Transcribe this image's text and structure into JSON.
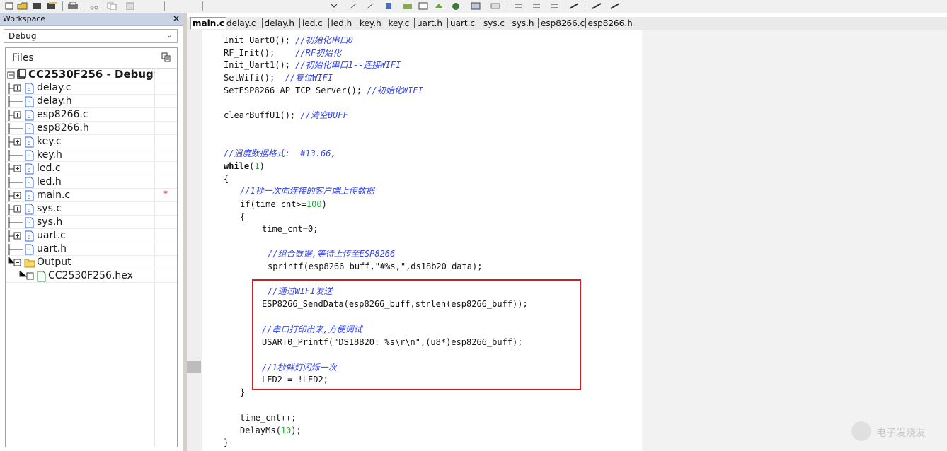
{
  "workspace": {
    "title": "Workspace",
    "close": "×",
    "config": "Debug",
    "files_header": "Files",
    "project": "CC2530F256 - Debug",
    "items": [
      {
        "name": "delay.c",
        "type": "c",
        "expandable": true
      },
      {
        "name": "delay.h",
        "type": "h",
        "expandable": false
      },
      {
        "name": "esp8266.c",
        "type": "c",
        "expandable": true
      },
      {
        "name": "esp8266.h",
        "type": "h",
        "expandable": false
      },
      {
        "name": "key.c",
        "type": "c",
        "expandable": true
      },
      {
        "name": "key.h",
        "type": "h",
        "expandable": false
      },
      {
        "name": "led.c",
        "type": "c",
        "expandable": true
      },
      {
        "name": "led.h",
        "type": "h",
        "expandable": false
      },
      {
        "name": "main.c",
        "type": "c",
        "expandable": true,
        "modified": "*"
      },
      {
        "name": "sys.c",
        "type": "c",
        "expandable": true
      },
      {
        "name": "sys.h",
        "type": "h",
        "expandable": false
      },
      {
        "name": "uart.c",
        "type": "c",
        "expandable": true
      },
      {
        "name": "uart.h",
        "type": "h",
        "expandable": false
      }
    ],
    "output_folder": "Output",
    "output_file": "CC2530F256.hex"
  },
  "editor": {
    "tabs": [
      "main.c",
      "delay.c",
      "delay.h",
      "led.c",
      "led.h",
      "key.h",
      "key.c",
      "uart.h",
      "uart.c",
      "sys.c",
      "sys.h",
      "esp8266.c",
      "esp8266.h"
    ],
    "active_tab": "main.c",
    "code": {
      "l1_code": "Init_Uart0(); ",
      "l1_cmt": "//初始化串口0",
      "l2_code": "RF_Init();    ",
      "l2_cmt": "//RF初始化",
      "l3_code": "Init_Uart1(); ",
      "l3_cmt": "//初始化串口1--连接WIFI",
      "l4_code": "SetWifi();  ",
      "l4_cmt": "//复位WIFI",
      "l5_code": "SetESP8266_AP_TCP_Server(); ",
      "l5_cmt": "//初始化WIFI",
      "l6_code": "clearBuffU1(); ",
      "l6_cmt": "//清空BUFF",
      "l7_cmt": "//温度数据格式:  #13.66,",
      "l8_kw": "while",
      "l8_open": "(",
      "l8_num": "1",
      "l8_close": ")",
      "l9": "{",
      "l10_cmt": "//1秒一次向连接的客户端上传数据",
      "l11_a": "if(time_cnt>=",
      "l11_num": "100",
      "l11_b": ")",
      "l12": "{",
      "l13": "time_cnt=0;",
      "l14_cmt": "//组合数据,等待上传至ESP8266",
      "l15": "sprintf(esp8266_buff,\"#%s,\",ds18b20_data);",
      "l16_cmt": "//通过WIFI发送",
      "l17": "ESP8266_SendData(esp8266_buff,strlen(esp8266_buff));",
      "l18_cmt": "//串口打印出来,方便调试",
      "l19": "USART0_Printf(\"DS18B20: %s\\r\\n\",(u8*)esp8266_buff);",
      "l20_cmt": "//1秒鲜灯闪烁一次",
      "l21": "LED2 = !LED2;",
      "l22": "}",
      "l23": "time_cnt++;",
      "l24_a": "DelayMs(",
      "l24_num": "10",
      "l24_b": ");",
      "l25": "}"
    }
  },
  "watermark": "电子发烧友"
}
